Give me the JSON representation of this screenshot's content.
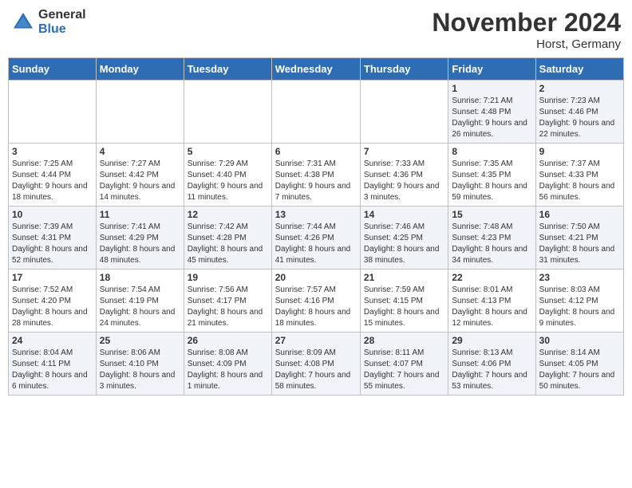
{
  "logo": {
    "general": "General",
    "blue": "Blue"
  },
  "title": "November 2024",
  "location": "Horst, Germany",
  "weekdays": [
    "Sunday",
    "Monday",
    "Tuesday",
    "Wednesday",
    "Thursday",
    "Friday",
    "Saturday"
  ],
  "weeks": [
    [
      {
        "day": "",
        "info": ""
      },
      {
        "day": "",
        "info": ""
      },
      {
        "day": "",
        "info": ""
      },
      {
        "day": "",
        "info": ""
      },
      {
        "day": "",
        "info": ""
      },
      {
        "day": "1",
        "info": "Sunrise: 7:21 AM\nSunset: 4:48 PM\nDaylight: 9 hours and 26 minutes."
      },
      {
        "day": "2",
        "info": "Sunrise: 7:23 AM\nSunset: 4:46 PM\nDaylight: 9 hours and 22 minutes."
      }
    ],
    [
      {
        "day": "3",
        "info": "Sunrise: 7:25 AM\nSunset: 4:44 PM\nDaylight: 9 hours and 18 minutes."
      },
      {
        "day": "4",
        "info": "Sunrise: 7:27 AM\nSunset: 4:42 PM\nDaylight: 9 hours and 14 minutes."
      },
      {
        "day": "5",
        "info": "Sunrise: 7:29 AM\nSunset: 4:40 PM\nDaylight: 9 hours and 11 minutes."
      },
      {
        "day": "6",
        "info": "Sunrise: 7:31 AM\nSunset: 4:38 PM\nDaylight: 9 hours and 7 minutes."
      },
      {
        "day": "7",
        "info": "Sunrise: 7:33 AM\nSunset: 4:36 PM\nDaylight: 9 hours and 3 minutes."
      },
      {
        "day": "8",
        "info": "Sunrise: 7:35 AM\nSunset: 4:35 PM\nDaylight: 8 hours and 59 minutes."
      },
      {
        "day": "9",
        "info": "Sunrise: 7:37 AM\nSunset: 4:33 PM\nDaylight: 8 hours and 56 minutes."
      }
    ],
    [
      {
        "day": "10",
        "info": "Sunrise: 7:39 AM\nSunset: 4:31 PM\nDaylight: 8 hours and 52 minutes."
      },
      {
        "day": "11",
        "info": "Sunrise: 7:41 AM\nSunset: 4:29 PM\nDaylight: 8 hours and 48 minutes."
      },
      {
        "day": "12",
        "info": "Sunrise: 7:42 AM\nSunset: 4:28 PM\nDaylight: 8 hours and 45 minutes."
      },
      {
        "day": "13",
        "info": "Sunrise: 7:44 AM\nSunset: 4:26 PM\nDaylight: 8 hours and 41 minutes."
      },
      {
        "day": "14",
        "info": "Sunrise: 7:46 AM\nSunset: 4:25 PM\nDaylight: 8 hours and 38 minutes."
      },
      {
        "day": "15",
        "info": "Sunrise: 7:48 AM\nSunset: 4:23 PM\nDaylight: 8 hours and 34 minutes."
      },
      {
        "day": "16",
        "info": "Sunrise: 7:50 AM\nSunset: 4:21 PM\nDaylight: 8 hours and 31 minutes."
      }
    ],
    [
      {
        "day": "17",
        "info": "Sunrise: 7:52 AM\nSunset: 4:20 PM\nDaylight: 8 hours and 28 minutes."
      },
      {
        "day": "18",
        "info": "Sunrise: 7:54 AM\nSunset: 4:19 PM\nDaylight: 8 hours and 24 minutes."
      },
      {
        "day": "19",
        "info": "Sunrise: 7:56 AM\nSunset: 4:17 PM\nDaylight: 8 hours and 21 minutes."
      },
      {
        "day": "20",
        "info": "Sunrise: 7:57 AM\nSunset: 4:16 PM\nDaylight: 8 hours and 18 minutes."
      },
      {
        "day": "21",
        "info": "Sunrise: 7:59 AM\nSunset: 4:15 PM\nDaylight: 8 hours and 15 minutes."
      },
      {
        "day": "22",
        "info": "Sunrise: 8:01 AM\nSunset: 4:13 PM\nDaylight: 8 hours and 12 minutes."
      },
      {
        "day": "23",
        "info": "Sunrise: 8:03 AM\nSunset: 4:12 PM\nDaylight: 8 hours and 9 minutes."
      }
    ],
    [
      {
        "day": "24",
        "info": "Sunrise: 8:04 AM\nSunset: 4:11 PM\nDaylight: 8 hours and 6 minutes."
      },
      {
        "day": "25",
        "info": "Sunrise: 8:06 AM\nSunset: 4:10 PM\nDaylight: 8 hours and 3 minutes."
      },
      {
        "day": "26",
        "info": "Sunrise: 8:08 AM\nSunset: 4:09 PM\nDaylight: 8 hours and 1 minute."
      },
      {
        "day": "27",
        "info": "Sunrise: 8:09 AM\nSunset: 4:08 PM\nDaylight: 7 hours and 58 minutes."
      },
      {
        "day": "28",
        "info": "Sunrise: 8:11 AM\nSunset: 4:07 PM\nDaylight: 7 hours and 55 minutes."
      },
      {
        "day": "29",
        "info": "Sunrise: 8:13 AM\nSunset: 4:06 PM\nDaylight: 7 hours and 53 minutes."
      },
      {
        "day": "30",
        "info": "Sunrise: 8:14 AM\nSunset: 4:05 PM\nDaylight: 7 hours and 50 minutes."
      }
    ]
  ]
}
